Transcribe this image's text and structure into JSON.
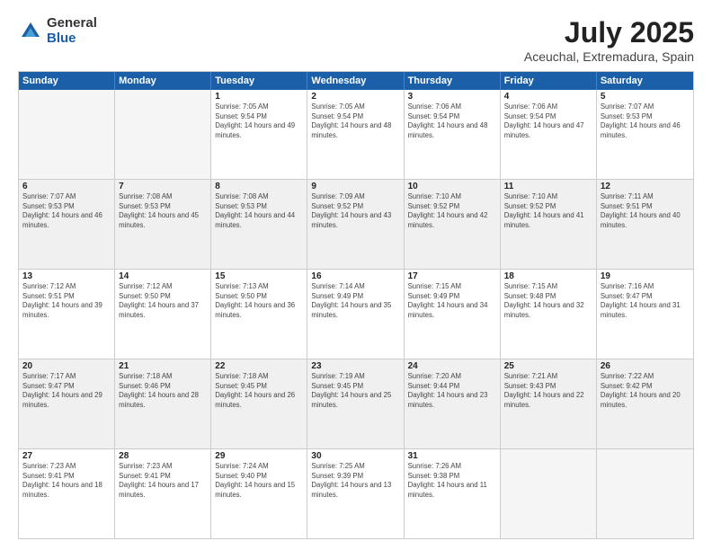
{
  "header": {
    "logo_general": "General",
    "logo_blue": "Blue",
    "title": "July 2025",
    "subtitle": "Aceuchal, Extremadura, Spain"
  },
  "calendar": {
    "weekdays": [
      "Sunday",
      "Monday",
      "Tuesday",
      "Wednesday",
      "Thursday",
      "Friday",
      "Saturday"
    ],
    "rows": [
      [
        {
          "day": "",
          "empty": true
        },
        {
          "day": "",
          "empty": true
        },
        {
          "day": "1",
          "sunrise": "7:05 AM",
          "sunset": "9:54 PM",
          "daylight": "14 hours and 49 minutes."
        },
        {
          "day": "2",
          "sunrise": "7:05 AM",
          "sunset": "9:54 PM",
          "daylight": "14 hours and 48 minutes."
        },
        {
          "day": "3",
          "sunrise": "7:06 AM",
          "sunset": "9:54 PM",
          "daylight": "14 hours and 48 minutes."
        },
        {
          "day": "4",
          "sunrise": "7:06 AM",
          "sunset": "9:54 PM",
          "daylight": "14 hours and 47 minutes."
        },
        {
          "day": "5",
          "sunrise": "7:07 AM",
          "sunset": "9:53 PM",
          "daylight": "14 hours and 46 minutes."
        }
      ],
      [
        {
          "day": "6",
          "sunrise": "7:07 AM",
          "sunset": "9:53 PM",
          "daylight": "14 hours and 46 minutes."
        },
        {
          "day": "7",
          "sunrise": "7:08 AM",
          "sunset": "9:53 PM",
          "daylight": "14 hours and 45 minutes."
        },
        {
          "day": "8",
          "sunrise": "7:08 AM",
          "sunset": "9:53 PM",
          "daylight": "14 hours and 44 minutes."
        },
        {
          "day": "9",
          "sunrise": "7:09 AM",
          "sunset": "9:52 PM",
          "daylight": "14 hours and 43 minutes."
        },
        {
          "day": "10",
          "sunrise": "7:10 AM",
          "sunset": "9:52 PM",
          "daylight": "14 hours and 42 minutes."
        },
        {
          "day": "11",
          "sunrise": "7:10 AM",
          "sunset": "9:52 PM",
          "daylight": "14 hours and 41 minutes."
        },
        {
          "day": "12",
          "sunrise": "7:11 AM",
          "sunset": "9:51 PM",
          "daylight": "14 hours and 40 minutes."
        }
      ],
      [
        {
          "day": "13",
          "sunrise": "7:12 AM",
          "sunset": "9:51 PM",
          "daylight": "14 hours and 39 minutes."
        },
        {
          "day": "14",
          "sunrise": "7:12 AM",
          "sunset": "9:50 PM",
          "daylight": "14 hours and 37 minutes."
        },
        {
          "day": "15",
          "sunrise": "7:13 AM",
          "sunset": "9:50 PM",
          "daylight": "14 hours and 36 minutes."
        },
        {
          "day": "16",
          "sunrise": "7:14 AM",
          "sunset": "9:49 PM",
          "daylight": "14 hours and 35 minutes."
        },
        {
          "day": "17",
          "sunrise": "7:15 AM",
          "sunset": "9:49 PM",
          "daylight": "14 hours and 34 minutes."
        },
        {
          "day": "18",
          "sunrise": "7:15 AM",
          "sunset": "9:48 PM",
          "daylight": "14 hours and 32 minutes."
        },
        {
          "day": "19",
          "sunrise": "7:16 AM",
          "sunset": "9:47 PM",
          "daylight": "14 hours and 31 minutes."
        }
      ],
      [
        {
          "day": "20",
          "sunrise": "7:17 AM",
          "sunset": "9:47 PM",
          "daylight": "14 hours and 29 minutes."
        },
        {
          "day": "21",
          "sunrise": "7:18 AM",
          "sunset": "9:46 PM",
          "daylight": "14 hours and 28 minutes."
        },
        {
          "day": "22",
          "sunrise": "7:18 AM",
          "sunset": "9:45 PM",
          "daylight": "14 hours and 26 minutes."
        },
        {
          "day": "23",
          "sunrise": "7:19 AM",
          "sunset": "9:45 PM",
          "daylight": "14 hours and 25 minutes."
        },
        {
          "day": "24",
          "sunrise": "7:20 AM",
          "sunset": "9:44 PM",
          "daylight": "14 hours and 23 minutes."
        },
        {
          "day": "25",
          "sunrise": "7:21 AM",
          "sunset": "9:43 PM",
          "daylight": "14 hours and 22 minutes."
        },
        {
          "day": "26",
          "sunrise": "7:22 AM",
          "sunset": "9:42 PM",
          "daylight": "14 hours and 20 minutes."
        }
      ],
      [
        {
          "day": "27",
          "sunrise": "7:23 AM",
          "sunset": "9:41 PM",
          "daylight": "14 hours and 18 minutes."
        },
        {
          "day": "28",
          "sunrise": "7:23 AM",
          "sunset": "9:41 PM",
          "daylight": "14 hours and 17 minutes."
        },
        {
          "day": "29",
          "sunrise": "7:24 AM",
          "sunset": "9:40 PM",
          "daylight": "14 hours and 15 minutes."
        },
        {
          "day": "30",
          "sunrise": "7:25 AM",
          "sunset": "9:39 PM",
          "daylight": "14 hours and 13 minutes."
        },
        {
          "day": "31",
          "sunrise": "7:26 AM",
          "sunset": "9:38 PM",
          "daylight": "14 hours and 11 minutes."
        },
        {
          "day": "",
          "empty": true
        },
        {
          "day": "",
          "empty": true
        }
      ]
    ]
  }
}
